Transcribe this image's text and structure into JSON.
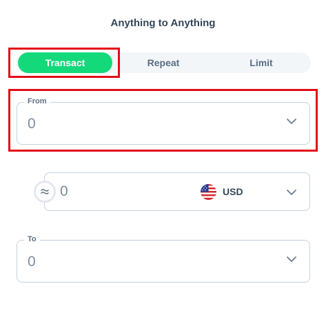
{
  "header": {
    "title": "Anything to Anything"
  },
  "tabs": [
    {
      "label": "Transact",
      "active": true
    },
    {
      "label": "Repeat",
      "active": false
    },
    {
      "label": "Limit",
      "active": false
    }
  ],
  "from_field": {
    "label": "From",
    "value": "0",
    "icon": "chevron-down-icon"
  },
  "amount_field": {
    "value": "0",
    "currency": "USD",
    "flag_icon": "us-flag-icon",
    "swap_icon": "swap-icon"
  },
  "to_field": {
    "label": "To",
    "value": "0",
    "icon": "chevron-down-icon"
  },
  "colors": {
    "accent": "#13d97b",
    "highlight": "#e30d17",
    "border": "#c6d0db",
    "text": "#34465a"
  }
}
